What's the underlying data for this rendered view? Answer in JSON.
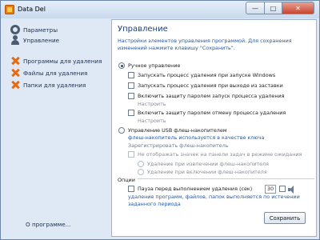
{
  "window": {
    "title": "Data Del",
    "min_glyph": "—",
    "max_glyph": "□",
    "close_glyph": "✕"
  },
  "sidebar": {
    "items": [
      {
        "label": "Параметры",
        "icon": "gear-icon"
      },
      {
        "label": "Управление",
        "icon": "users-icon"
      },
      {
        "label": "Программы для удаления",
        "icon": "delete-icon"
      },
      {
        "label": "Файлы для удаления",
        "icon": "delete-icon"
      },
      {
        "label": "Папки для удаления",
        "icon": "delete-icon"
      }
    ],
    "about": "О программе..."
  },
  "panel": {
    "title": "Управление",
    "description": "Настройки элементов управления программой. Для сохранения изменений нажмите клавишу \"Сохранить\".",
    "manual": {
      "label": "Ручное управление",
      "options": [
        "Запускать процесс удаления при запуске Windows",
        "Запускать процесс удаления при выходе из заставки",
        "Включить защиту паролем запуск процесса удаления",
        "Включить защиту паролем отмену процесса удаления"
      ],
      "configure": "Настроить"
    },
    "usb": {
      "label": "Управление USB флеш-накопителем",
      "note": "флеш-накопитель используется в качестве ключа",
      "register": "Зарегистрировать флеш-накопитель",
      "hide_icon": "Не отображать значек на панели задач в режиме ожидания",
      "on_remove": "Удаление при извлечении флеш-накопителя",
      "on_insert": "Удаление при включении флеш-накопителя"
    },
    "options": {
      "label": "Опции",
      "pause_label": "Пауза перед выполнением удаления (сек)",
      "pause_value": "30",
      "pause_note": "удаление программ, файлов, папок выполняется по истечении заданного периода"
    },
    "save_label": "Сохранить"
  }
}
